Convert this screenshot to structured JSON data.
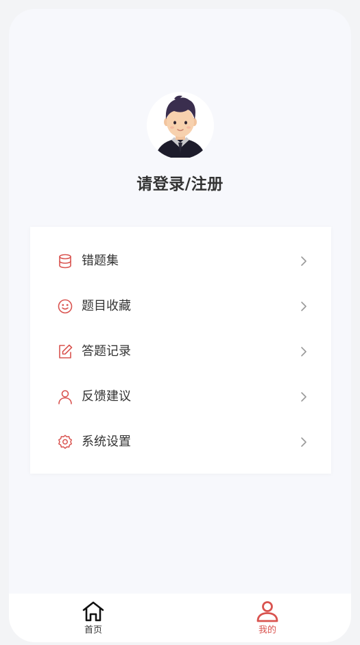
{
  "profile": {
    "login_text": "请登录/注册"
  },
  "menu": {
    "items": [
      {
        "label": "错题集",
        "icon": "database-icon"
      },
      {
        "label": "题目收藏",
        "icon": "smile-icon"
      },
      {
        "label": "答题记录",
        "icon": "edit-icon"
      },
      {
        "label": "反馈建议",
        "icon": "user-icon"
      },
      {
        "label": "系统设置",
        "icon": "gear-icon"
      }
    ]
  },
  "tabbar": {
    "tabs": [
      {
        "label": "首页",
        "icon": "home-icon",
        "active": false
      },
      {
        "label": "我的",
        "icon": "user-icon",
        "active": true
      }
    ]
  },
  "colors": {
    "accent": "#d9534f",
    "text": "#333333",
    "chevron": "#999999",
    "background": "#f7f8fc"
  }
}
